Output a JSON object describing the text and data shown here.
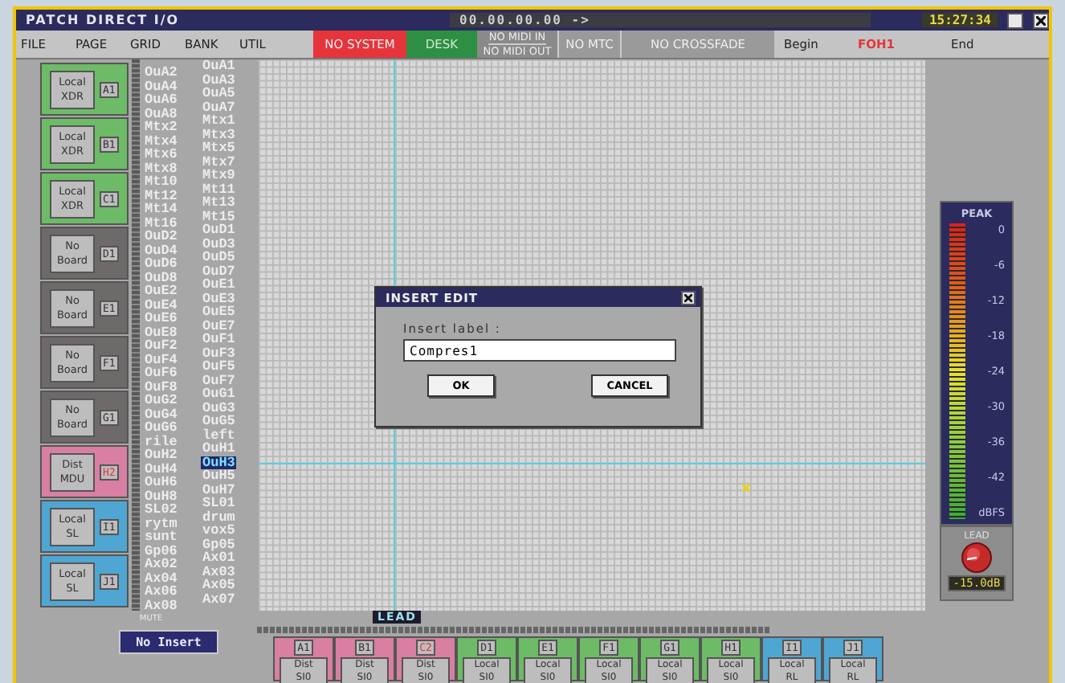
{
  "window": {
    "title": "PATCH DIRECT I/O",
    "timecode": "00.00.00.00 ->",
    "clock": "15:27:34"
  },
  "menu": [
    "FILE",
    "PAGE",
    "GRID",
    "BANK",
    "UTIL"
  ],
  "status": [
    {
      "kind": "alert",
      "text": "NO SYSTEM"
    },
    {
      "kind": "ok",
      "text": "DESK"
    },
    {
      "kind": "double",
      "lines": [
        "NO MIDI IN",
        "NO MIDI OUT"
      ]
    },
    {
      "kind": "off",
      "text": "NO MTC"
    },
    {
      "kind": "off",
      "text": "NO CROSSFADE"
    },
    {
      "kind": "plain",
      "text": "Begin"
    },
    {
      "kind": "alert-text",
      "text": "FOH1"
    },
    {
      "kind": "plain",
      "text": "End"
    }
  ],
  "boards": [
    {
      "lines": [
        "Local",
        "XDR"
      ],
      "slot": "A1",
      "color": "#6dbb66",
      "alert": false
    },
    {
      "lines": [
        "Local",
        "XDR"
      ],
      "slot": "B1",
      "color": "#6dbb66",
      "alert": false
    },
    {
      "lines": [
        "Local",
        "XDR"
      ],
      "slot": "C1",
      "color": "#6dbb66",
      "alert": false
    },
    {
      "lines": [
        "No",
        "Board"
      ],
      "slot": "D1",
      "color": "#6f6a6a",
      "alert": false
    },
    {
      "lines": [
        "No",
        "Board"
      ],
      "slot": "E1",
      "color": "#6f6a6a",
      "alert": false
    },
    {
      "lines": [
        "No",
        "Board"
      ],
      "slot": "F1",
      "color": "#6f6a6a",
      "alert": false
    },
    {
      "lines": [
        "No",
        "Board"
      ],
      "slot": "G1",
      "color": "#6f6a6a",
      "alert": false
    },
    {
      "lines": [
        "Dist",
        "MDU"
      ],
      "slot": "H2",
      "color": "#d87fa2",
      "alert": true
    },
    {
      "lines": [
        "Local",
        "SL"
      ],
      "slot": "I1",
      "color": "#4fa6d2",
      "alert": false
    },
    {
      "lines": [
        "Local",
        "SL"
      ],
      "slot": "J1",
      "color": "#4fa6d2",
      "alert": false
    }
  ],
  "outputs_even": [
    {
      "label": "OuA2",
      "selected": false
    },
    {
      "label": "OuA4",
      "selected": false
    },
    {
      "label": "OuA6",
      "selected": false
    },
    {
      "label": "OuA8",
      "selected": false
    },
    {
      "label": "Mtx2",
      "selected": false
    },
    {
      "label": "Mtx4",
      "selected": false
    },
    {
      "label": "Mtx6",
      "selected": false
    },
    {
      "label": "Mtx8",
      "selected": false
    },
    {
      "label": "Mt10",
      "selected": false
    },
    {
      "label": "Mt12",
      "selected": false
    },
    {
      "label": "Mt14",
      "selected": false
    },
    {
      "label": "Mt16",
      "selected": false
    },
    {
      "label": "OuD2",
      "selected": false
    },
    {
      "label": "OuD4",
      "selected": false
    },
    {
      "label": "OuD6",
      "selected": false
    },
    {
      "label": "OuD8",
      "selected": false
    },
    {
      "label": "OuE2",
      "selected": false
    },
    {
      "label": "OuE4",
      "selected": false
    },
    {
      "label": "OuE6",
      "selected": false
    },
    {
      "label": "OuE8",
      "selected": false
    },
    {
      "label": "OuF2",
      "selected": false
    },
    {
      "label": "OuF4",
      "selected": false
    },
    {
      "label": "OuF6",
      "selected": false
    },
    {
      "label": "OuF8",
      "selected": false
    },
    {
      "label": "OuG2",
      "selected": false
    },
    {
      "label": "OuG4",
      "selected": false
    },
    {
      "label": "OuG6",
      "selected": false
    },
    {
      "label": "rile",
      "selected": false
    },
    {
      "label": "OuH2",
      "selected": false
    },
    {
      "label": "OuH4",
      "selected": false
    },
    {
      "label": "OuH6",
      "selected": false
    },
    {
      "label": "OuH8",
      "selected": false
    },
    {
      "label": "SL02",
      "selected": false
    },
    {
      "label": "rytm",
      "selected": false
    },
    {
      "label": "sunt",
      "selected": false
    },
    {
      "label": "Gp06",
      "selected": false
    },
    {
      "label": "Ax02",
      "selected": false
    },
    {
      "label": "Ax04",
      "selected": false
    },
    {
      "label": "Ax06",
      "selected": false
    },
    {
      "label": "Ax08",
      "selected": false
    }
  ],
  "outputs_odd": [
    {
      "label": "OuA1",
      "selected": false
    },
    {
      "label": "OuA3",
      "selected": false
    },
    {
      "label": "OuA5",
      "selected": false
    },
    {
      "label": "OuA7",
      "selected": false
    },
    {
      "label": "Mtx1",
      "selected": false
    },
    {
      "label": "Mtx3",
      "selected": false
    },
    {
      "label": "Mtx5",
      "selected": false
    },
    {
      "label": "Mtx7",
      "selected": false
    },
    {
      "label": "Mtx9",
      "selected": false
    },
    {
      "label": "Mt11",
      "selected": false
    },
    {
      "label": "Mt13",
      "selected": false
    },
    {
      "label": "Mt15",
      "selected": false
    },
    {
      "label": "OuD1",
      "selected": false
    },
    {
      "label": "OuD3",
      "selected": false
    },
    {
      "label": "OuD5",
      "selected": false
    },
    {
      "label": "OuD7",
      "selected": false
    },
    {
      "label": "OuE1",
      "selected": false
    },
    {
      "label": "OuE3",
      "selected": false
    },
    {
      "label": "OuE5",
      "selected": false
    },
    {
      "label": "OuE7",
      "selected": false
    },
    {
      "label": "OuF1",
      "selected": false
    },
    {
      "label": "OuF3",
      "selected": false
    },
    {
      "label": "OuF5",
      "selected": false
    },
    {
      "label": "OuF7",
      "selected": false
    },
    {
      "label": "OuG1",
      "selected": false
    },
    {
      "label": "OuG3",
      "selected": false
    },
    {
      "label": "OuG5",
      "selected": false
    },
    {
      "label": "left",
      "selected": false
    },
    {
      "label": "OuH1",
      "selected": false
    },
    {
      "label": "OuH3",
      "selected": true
    },
    {
      "label": "OuH5",
      "selected": false
    },
    {
      "label": "OuH7",
      "selected": false
    },
    {
      "label": "SL01",
      "selected": false
    },
    {
      "label": "drum",
      "selected": false
    },
    {
      "label": "vox5",
      "selected": false
    },
    {
      "label": "Gp05",
      "selected": false
    },
    {
      "label": "Ax01",
      "selected": false
    },
    {
      "label": "Ax03",
      "selected": false
    },
    {
      "label": "Ax05",
      "selected": false
    },
    {
      "label": "Ax07",
      "selected": false
    }
  ],
  "meter": {
    "title": "PEAK",
    "level": 1,
    "scale": [
      "0",
      "-6",
      "-12",
      "-18",
      "-24",
      "-30",
      "-36",
      "-42"
    ],
    "unit": "dBFS",
    "knob_label": "LEAD",
    "readout": "-15.0dB"
  },
  "dialog": {
    "title": "INSERT EDIT",
    "prompt": "Insert label :",
    "value": "Compres1",
    "buttons": [
      "OK",
      "CANCEL"
    ]
  },
  "mute_label": "MUTE",
  "insert_button": "No Insert",
  "lead_label": "LEAD",
  "inputs": [
    {
      "slot": "A1",
      "lines": [
        "Dist",
        "SI0"
      ],
      "color": "#d87fa2",
      "alert": false
    },
    {
      "slot": "B1",
      "lines": [
        "Dist",
        "SI0"
      ],
      "color": "#d87fa2",
      "alert": false
    },
    {
      "slot": "C2",
      "lines": [
        "Dist",
        "SI0"
      ],
      "color": "#d87fa2",
      "alert": true
    },
    {
      "slot": "D1",
      "lines": [
        "Local",
        "SI0"
      ],
      "color": "#6dbb66",
      "alert": false
    },
    {
      "slot": "E1",
      "lines": [
        "Local",
        "SI0"
      ],
      "color": "#6dbb66",
      "alert": false
    },
    {
      "slot": "F1",
      "lines": [
        "Local",
        "SI0"
      ],
      "color": "#6dbb66",
      "alert": false
    },
    {
      "slot": "G1",
      "lines": [
        "Local",
        "SI0"
      ],
      "color": "#6dbb66",
      "alert": false
    },
    {
      "slot": "H1",
      "lines": [
        "Local",
        "SI0"
      ],
      "color": "#6dbb66",
      "alert": false
    },
    {
      "slot": "I1",
      "lines": [
        "Local",
        "RL"
      ],
      "color": "#4fa6d2",
      "alert": false
    },
    {
      "slot": "J1",
      "lines": [
        "Local",
        "RL"
      ],
      "color": "#4fa6d2",
      "alert": false
    }
  ]
}
